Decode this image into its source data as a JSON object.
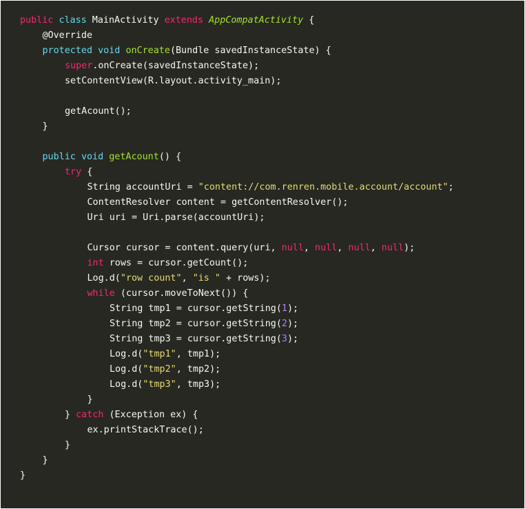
{
  "code": {
    "l1": {
      "t1": "public",
      "t2": " ",
      "t3": "class",
      "t4": " MainActivity ",
      "t5": "extends",
      "t6": " ",
      "t7": "AppCompatActivity",
      "t8": " {"
    },
    "l2": {
      "t1": "@Override"
    },
    "l3": {
      "t1": "protected",
      "t2": " ",
      "t3": "void",
      "t4": " ",
      "t5": "onCreate",
      "t6": "(Bundle savedInstanceState) {"
    },
    "l4": {
      "t1": "super",
      "t2": ".onCreate(savedInstanceState);"
    },
    "l5": {
      "t1": "setContentView(R.layout.activity_main);"
    },
    "l6": {
      "t1": ""
    },
    "l7": {
      "t1": "getAcount();"
    },
    "l8": {
      "t1": "}"
    },
    "l9": {
      "t1": ""
    },
    "l10": {
      "t1": "public",
      "t2": " ",
      "t3": "void",
      "t4": " ",
      "t5": "getAcount",
      "t6": "() {"
    },
    "l11": {
      "t1": "try",
      "t2": " {"
    },
    "l12": {
      "t1": "String accountUri = ",
      "t2": "\"content://com.renren.mobile.account/account\"",
      "t3": ";"
    },
    "l13": {
      "t1": "ContentResolver content = getContentResolver();"
    },
    "l14": {
      "t1": "Uri uri = Uri.parse(accountUri);"
    },
    "l15": {
      "t1": ""
    },
    "l16": {
      "t1": "Cursor cursor = content.query(uri, ",
      "t2": "null",
      "t3": ", ",
      "t4": "null",
      "t5": ", ",
      "t6": "null",
      "t7": ", ",
      "t8": "null",
      "t9": ");"
    },
    "l17": {
      "t1": "int",
      "t2": " rows = cursor.getCount();"
    },
    "l18": {
      "t1": "Log.d(",
      "t2": "\"row count\"",
      "t3": ", ",
      "t4": "\"is \"",
      "t5": " + rows);"
    },
    "l19": {
      "t1": "while",
      "t2": " (cursor.moveToNext()) {"
    },
    "l20": {
      "t1": "String tmp1 = cursor.getString(",
      "t2": "1",
      "t3": ");"
    },
    "l21": {
      "t1": "String tmp2 = cursor.getString(",
      "t2": "2",
      "t3": ");"
    },
    "l22": {
      "t1": "String tmp3 = cursor.getString(",
      "t2": "3",
      "t3": ");"
    },
    "l23": {
      "t1": "Log.d(",
      "t2": "\"tmp1\"",
      "t3": ", tmp1);"
    },
    "l24": {
      "t1": "Log.d(",
      "t2": "\"tmp2\"",
      "t3": ", tmp2);"
    },
    "l25": {
      "t1": "Log.d(",
      "t2": "\"tmp3\"",
      "t3": ", tmp3);"
    },
    "l26": {
      "t1": "}"
    },
    "l27": {
      "t1": "} ",
      "t2": "catch",
      "t3": " (Exception ex) {"
    },
    "l28": {
      "t1": "ex.printStackTrace();"
    },
    "l29": {
      "t1": "}"
    },
    "l30": {
      "t1": "}"
    },
    "l31": {
      "t1": "}"
    }
  },
  "colors": {
    "background": "#272822",
    "text": "#f8f8f2",
    "keyword": "#66d9ef",
    "keyword_control": "#f92672",
    "string": "#e6db74",
    "function": "#a6e22e",
    "number": "#ae81ff"
  }
}
